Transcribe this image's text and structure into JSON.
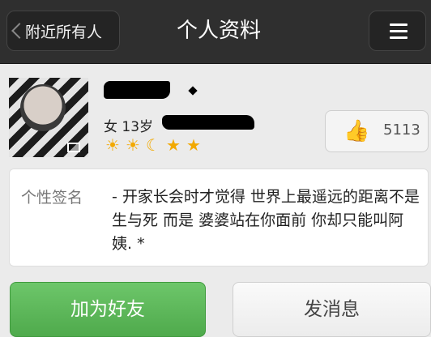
{
  "header": {
    "back_label": "附近所有人",
    "title": "个人资料"
  },
  "profile": {
    "gender_age": "女 13岁",
    "level_icons": [
      "sun-icon",
      "sun-icon",
      "moon-icon",
      "star-icon",
      "star-icon"
    ],
    "like_count": "5113"
  },
  "signature": {
    "label": "个性签名",
    "text": "- 开家长会时才觉得 世界上最遥远的距离不是生与死 而是 婆婆站在你面前 你却只能叫阿姨. *"
  },
  "actions": {
    "add_friend": "加为好友",
    "send_message": "发消息"
  },
  "colors": {
    "topbar": "#2f2f2f",
    "add_button": "#5cb85a",
    "level_icon": "#f2a900"
  }
}
